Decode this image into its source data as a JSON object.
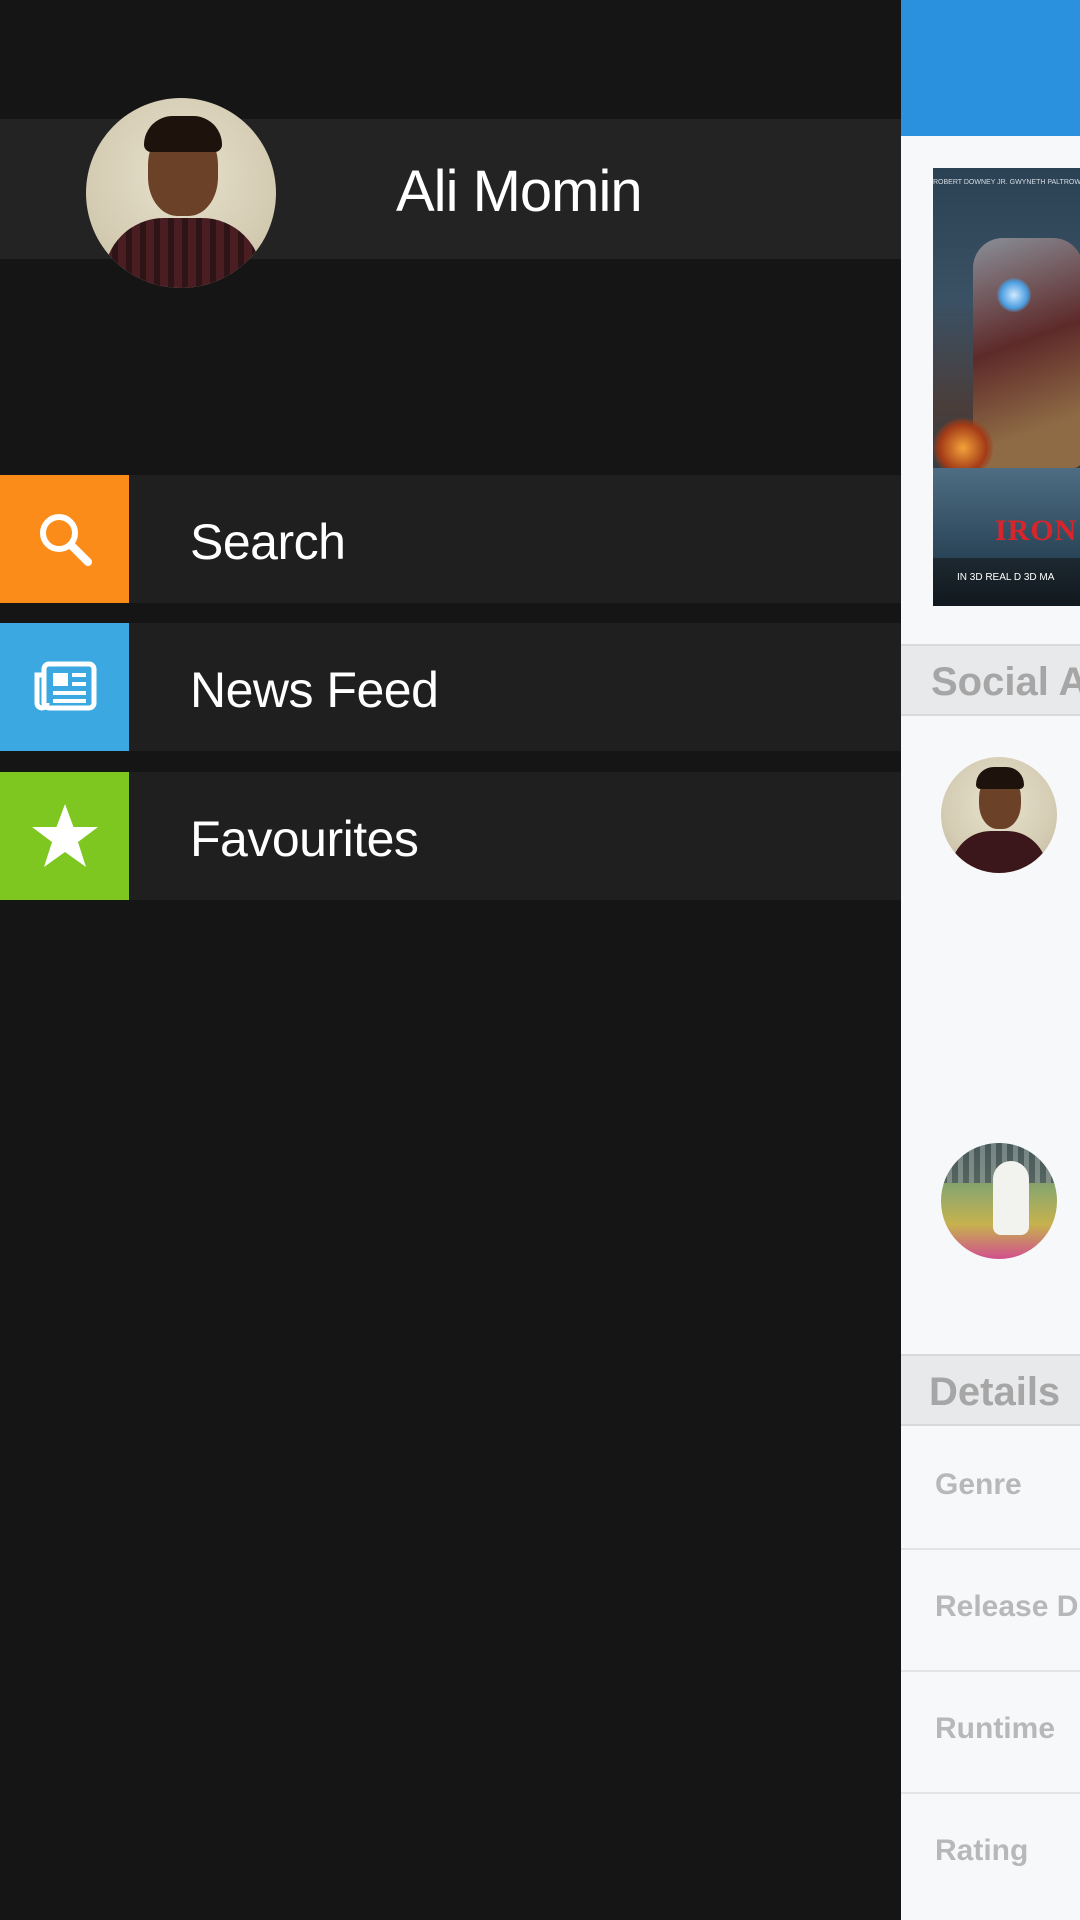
{
  "drawer": {
    "profile": {
      "name": "Ali Momin",
      "avatar_icon": "user-photo"
    },
    "menu": [
      {
        "label": "Search",
        "icon": "search-icon",
        "color": "#fc8c19"
      },
      {
        "label": "News Feed",
        "icon": "newspaper-icon",
        "color": "#3ba8e1"
      },
      {
        "label": "Favourites",
        "icon": "star-icon",
        "color": "#7dc720"
      }
    ],
    "background": "#151515",
    "row_background": "#1f1f1f"
  },
  "content": {
    "topbar_color": "#2a91de",
    "poster": {
      "credits": "ROBERT DOWNEY JR.   GWYNETH PALTROW   CH",
      "title": "IRON",
      "release": "IN 3D  REAL D 3D  MA"
    },
    "sections": {
      "social": "Social A",
      "details": "Details"
    },
    "details_rows": [
      "Genre",
      "Release D",
      "Runtime",
      "Rating"
    ]
  }
}
